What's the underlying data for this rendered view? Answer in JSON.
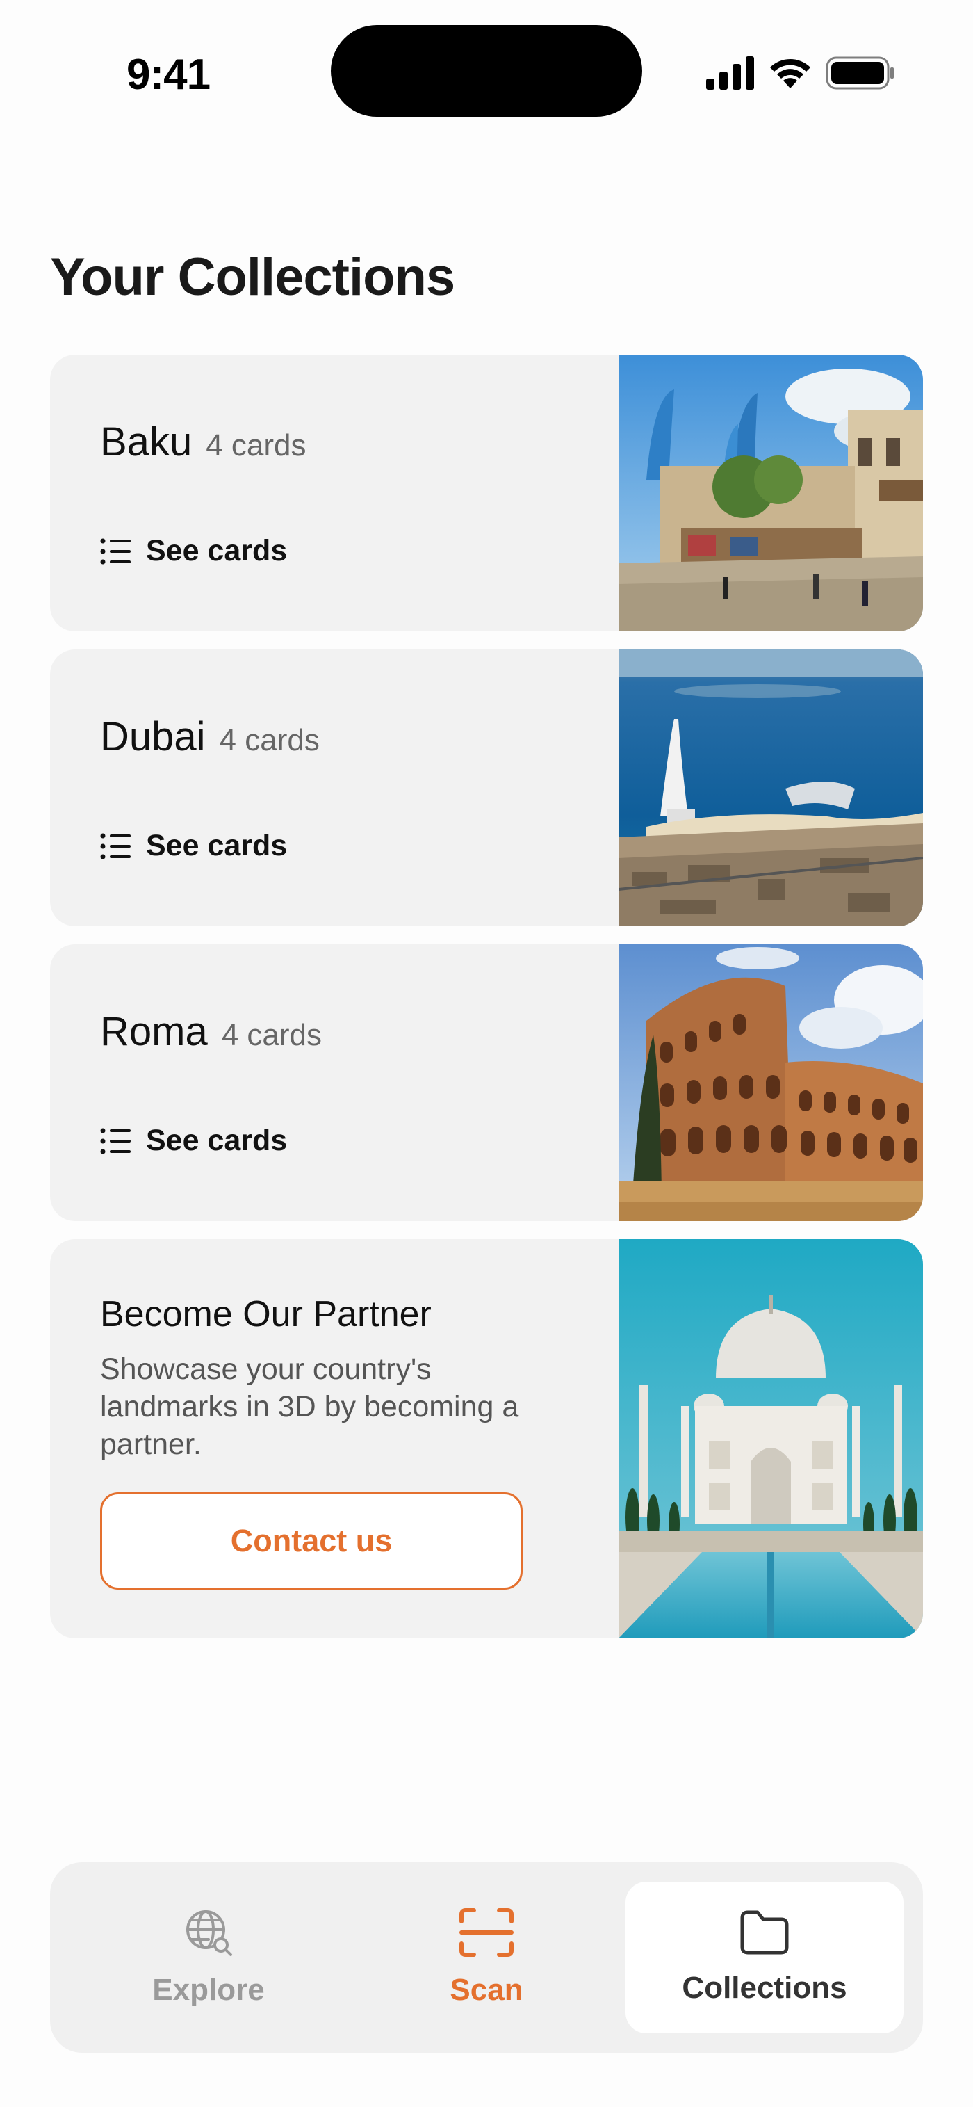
{
  "status_bar": {
    "time": "9:41"
  },
  "header": {
    "title": "Your Collections"
  },
  "collections": [
    {
      "name": "Baku",
      "count": "4 cards",
      "action": "See cards",
      "photo_icon": "baku-flame-towers-photo"
    },
    {
      "name": "Dubai",
      "count": "4 cards",
      "action": "See cards",
      "photo_icon": "dubai-burj-al-arab-photo"
    },
    {
      "name": "Roma",
      "count": "4 cards",
      "action": "See cards",
      "photo_icon": "rome-colosseum-photo"
    }
  ],
  "partner": {
    "title": "Become Our Partner",
    "description": "Showcase your country's landmarks in 3D by becoming a partner.",
    "button": "Contact us",
    "photo_icon": "taj-mahal-photo"
  },
  "tabbar": {
    "tabs": [
      {
        "label": "Explore",
        "icon": "globe-search-icon"
      },
      {
        "label": "Scan",
        "icon": "scan-frame-icon"
      },
      {
        "label": "Collections",
        "icon": "folder-icon"
      }
    ],
    "selected": "Collections"
  },
  "colors": {
    "accent": "#e4702e",
    "card_bg": "#f2f2f2",
    "tabbar_bg": "#f0f0f0"
  }
}
